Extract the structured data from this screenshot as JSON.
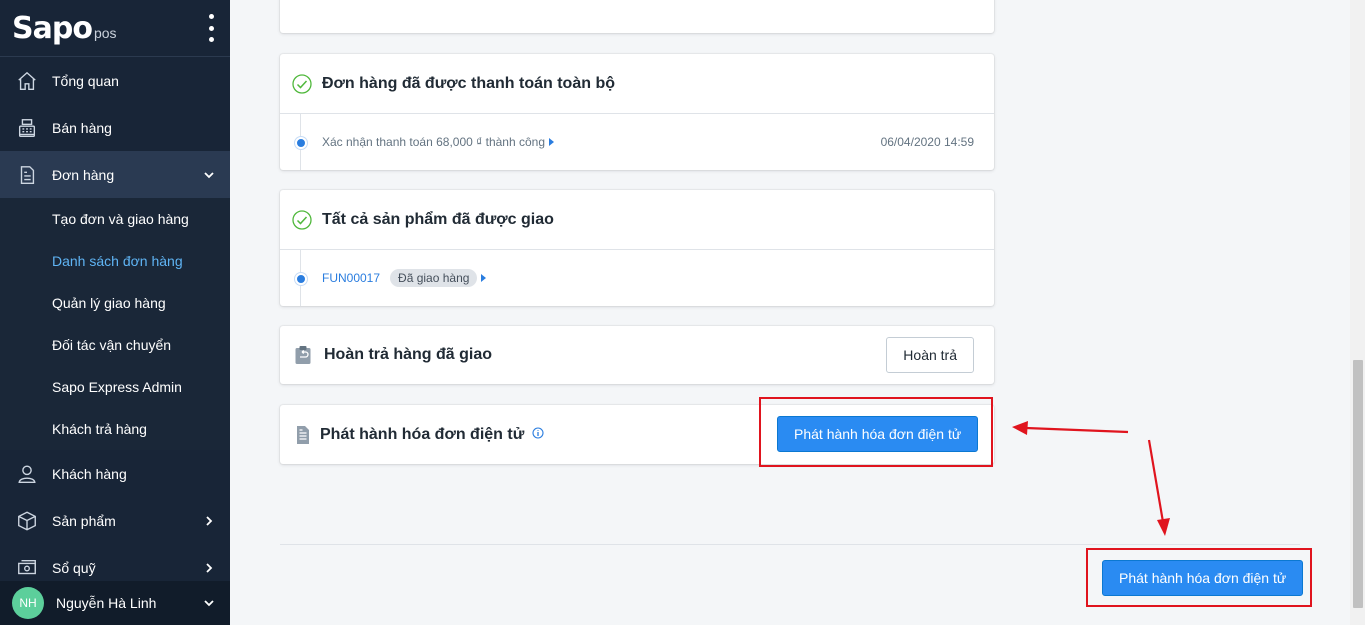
{
  "sidebar": {
    "logo_main": "Sapo",
    "logo_sub": "pos",
    "items": [
      {
        "label": "Tổng quan"
      },
      {
        "label": "Bán hàng"
      },
      {
        "label": "Đơn hàng"
      },
      {
        "label": "Khách hàng"
      },
      {
        "label": "Sản phẩm"
      },
      {
        "label": "Sổ quỹ"
      }
    ],
    "submenu": [
      {
        "label": "Tạo đơn và giao hàng"
      },
      {
        "label": "Danh sách đơn hàng"
      },
      {
        "label": "Quản lý giao hàng"
      },
      {
        "label": "Đối tác vận chuyển"
      },
      {
        "label": "Sapo Express Admin"
      },
      {
        "label": "Khách trả hàng"
      }
    ],
    "user": {
      "initials": "NH",
      "name": "Nguyễn Hà Linh"
    }
  },
  "payment": {
    "title": "Đơn hàng đã được thanh toán toàn bộ",
    "event": "Xác nhận thanh toán 68,000 ₫ thành công",
    "datetime": "06/04/2020 14:59"
  },
  "delivery": {
    "title": "Tất cả sản phẩm đã được giao",
    "code": "FUN00017",
    "status": "Đã giao hàng"
  },
  "returns": {
    "title": "Hoàn trả hàng đã giao",
    "button": "Hoàn trả"
  },
  "einvoice": {
    "title": "Phát hành hóa đơn điện tử",
    "button": "Phát hành hóa đơn điện tử"
  },
  "footer": {
    "button": "Phát hành hóa đơn điện tử"
  },
  "colors": {
    "sidebar_bg": "#182537",
    "accent": "#2a8bf2",
    "highlight": "#e0141e",
    "success": "#50b83c"
  }
}
